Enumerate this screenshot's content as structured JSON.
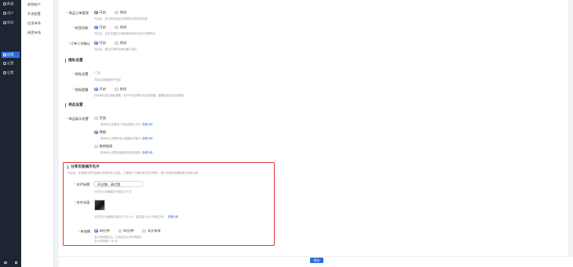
{
  "nav_primary": {
    "items": [
      {
        "label": "数据",
        "active": false
      },
      {
        "label": "用户",
        "active": false
      },
      {
        "label": "财务",
        "active": false
      },
      {
        "label": "应用",
        "active": true
      },
      {
        "label": "设置",
        "active": false
      },
      {
        "label": "设置",
        "active": false
      }
    ]
  },
  "nav_secondary": {
    "items": [
      "收款账户",
      "开发配置",
      "应用市场",
      "接受市场"
    ]
  },
  "settings": {
    "group1": {
      "row1": {
        "label": "商品订单管理",
        "opt_on": "开启",
        "opt_off": "关闭",
        "help": "开启后，支付成功后会自动跳转对应商品页面"
      },
      "row2": {
        "label": "拼团功能",
        "opt_on": "开启",
        "opt_off": "关闭",
        "help": "开启后，会员可通过分享链接邀请好友参与拼团购买"
      },
      "row3": {
        "label": "订单二次确认",
        "opt_on": "开启",
        "opt_off": "关闭",
        "help": "开启后，提交订单时会弹出确认提示"
      }
    },
    "section_privacy": {
      "title": "隐私设置"
    },
    "privacy_rows": {
      "row1": {
        "label": "隐私设置",
        "help": "开启后将隐藏用户信息"
      },
      "row2": {
        "label": "隐私提醒",
        "opt_on": "开启",
        "opt_off": "关闭",
        "help": "在商城中显示隐私提醒，用户可在设置中关闭该提醒，隐藏信息会在页面展示"
      }
    },
    "section_product": {
      "title": "商品设置"
    },
    "product_rows": {
      "label": "商品展示设置",
      "opt1": {
        "label": "页面",
        "help": "商家可以设置某个商品的展示方式",
        "link": "查看示例"
      },
      "opt2": {
        "label": "弹窗",
        "help": "商家可以设置商品以弹窗形式展示",
        "link": "查看示例"
      },
      "opt3": {
        "label": "跳转链接",
        "help": "商家可以设置商品跳转到指定链接",
        "link": "查看示例"
      }
    }
  },
  "card_section": {
    "title": "分享页面展示名片",
    "desc": "开启后，在商城分享时会展示商家的名片信息，方便用户了解商家并进行联系，提升商家的品牌影响力和转化率。",
    "name_label": "名片标题",
    "name_value": "开店铺，请点我",
    "name_help": "分享名片标题建议不超过14个字",
    "cover_label": "名片封面",
    "cover_help": "分享名片封面图片建议尺寸为 5:4，建议图片大小不超过2M。",
    "cover_link": "查看示例",
    "duration_label": "有效期",
    "duration_options": [
      "30分钟",
      "60分钟",
      "永久有效"
    ],
    "duration_help1": "名片有效期过后，分享的名片将不再展示",
    "duration_help2": "名片有效期 1~30 天"
  },
  "footer": {
    "save_label": "保存"
  },
  "colors": {
    "accent": "#2d6fd9",
    "highlight": "#e53935",
    "sidebar": "#1d2532"
  }
}
